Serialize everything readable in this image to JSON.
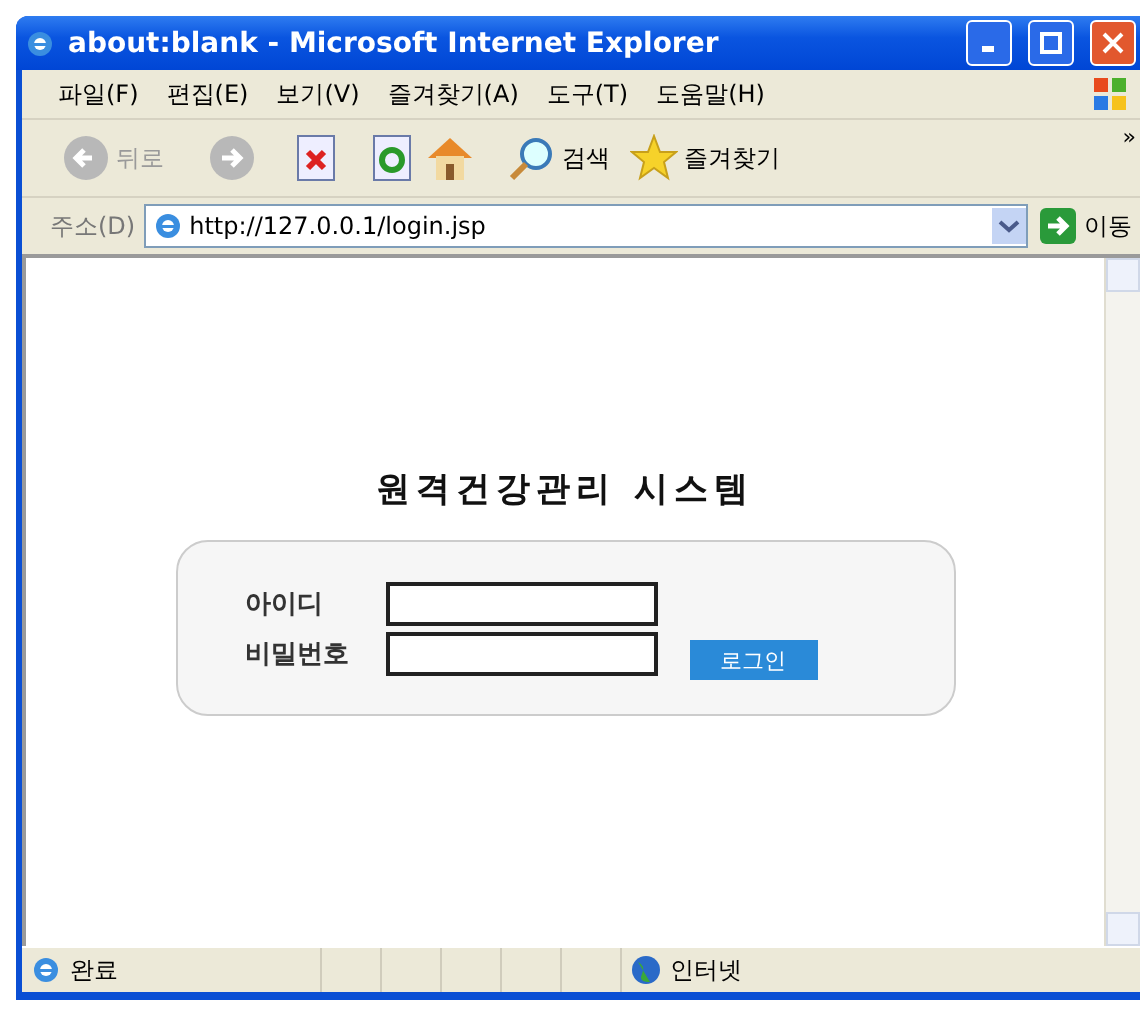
{
  "window": {
    "title": "about:blank - Microsoft Internet Explorer"
  },
  "menu": [
    {
      "label": "파일(F)"
    },
    {
      "label": "편집(E)"
    },
    {
      "label": "보기(V)"
    },
    {
      "label": "즐겨찾기(A)"
    },
    {
      "label": "도구(T)"
    },
    {
      "label": "도움말(H)"
    }
  ],
  "toolbar": {
    "back": {
      "label": "뒤로",
      "disabled": true
    },
    "search": "검색",
    "favorites": "즐겨찾기",
    "more": "»"
  },
  "address": {
    "label": "주소(D)",
    "url": "http://127.0.0.1/login.jsp",
    "go": "이동"
  },
  "page": {
    "heading": "원격건강관리 시스템",
    "fields": [
      {
        "label": "아이디"
      },
      {
        "label": "비밀번호"
      }
    ],
    "login_button": "로그인"
  },
  "status_bar": {
    "status": "완료",
    "zone": "인터넷"
  }
}
